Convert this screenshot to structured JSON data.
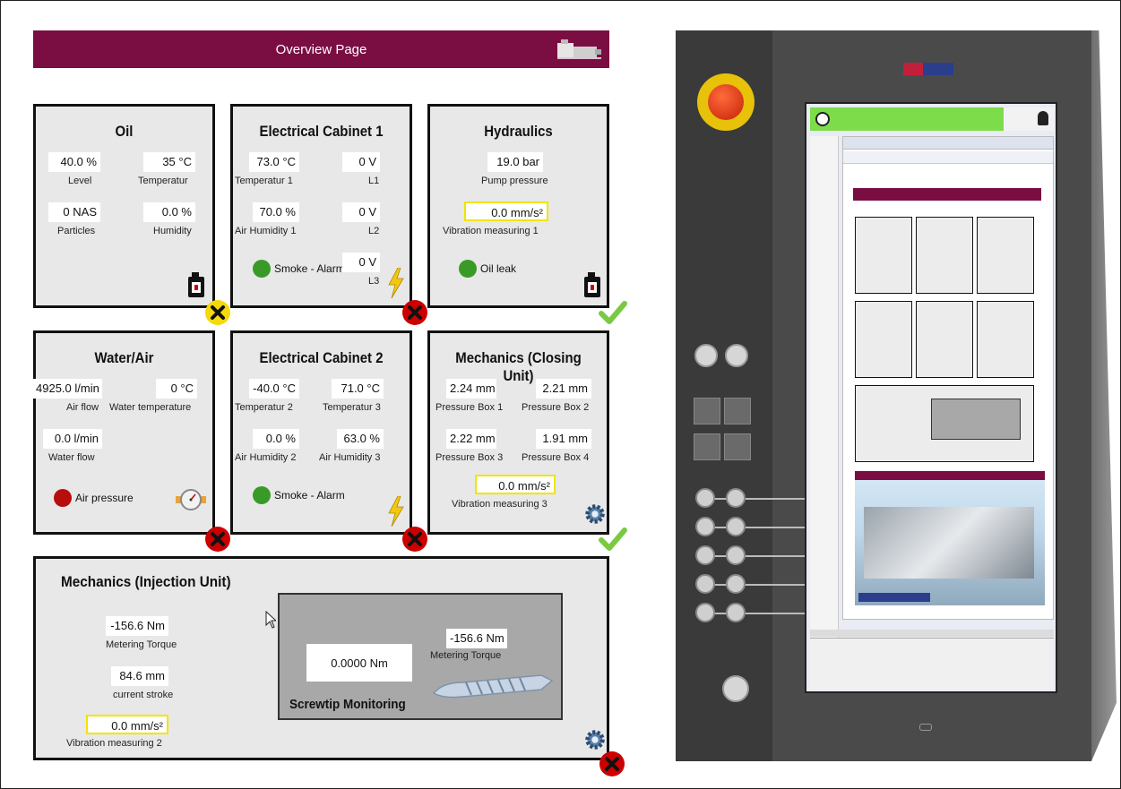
{
  "overview": {
    "title": "Overview Page",
    "panels": {
      "oil": {
        "title": "Oil",
        "level_value": "40.0 %",
        "level_label": "Level",
        "temp_value": "35 °C",
        "temp_label": "Temperatur",
        "particles_value": "0 NAS",
        "particles_label": "Particles",
        "humidity_value": "0.0 %",
        "humidity_label": "Humidity",
        "status": "warning"
      },
      "cabinet1": {
        "title": "Electrical Cabinet 1",
        "temp1_value": "73.0 °C",
        "temp1_label": "Temperatur 1",
        "l1_value": "0 V",
        "l1_label": "L1",
        "hum1_value": "70.0 %",
        "hum1_label": "Air Humidity 1",
        "l2_value": "0 V",
        "l2_label": "L2",
        "smoke_label": "Smoke - Alarm",
        "l3_value": "0 V",
        "l3_label": "L3",
        "status": "error"
      },
      "hydraulics": {
        "title": "Hydraulics",
        "pressure_value": "19.0 bar",
        "pressure_label": "Pump pressure",
        "vib_value": "0.0 mm/s²",
        "vib_label": "Vibration measuring 1",
        "leak_label": "Oil leak",
        "status": "ok"
      },
      "water_air": {
        "title": "Water/Air",
        "airflow_value": "4925.0 l/min",
        "airflow_label": "Air flow",
        "watertemp_value": "0 °C",
        "watertemp_label": "Water temperature",
        "waterflow_value": "0.0 l/min",
        "waterflow_label": "Water flow",
        "airpressure_label": "Air pressure",
        "status": "error"
      },
      "cabinet2": {
        "title": "Electrical Cabinet 2",
        "temp2_value": "-40.0 °C",
        "temp2_label": "Temperatur 2",
        "temp3_value": "71.0 °C",
        "temp3_label": "Temperatur 3",
        "hum2_value": "0.0 %",
        "hum2_label": "Air Humidity 2",
        "hum3_value": "63.0 %",
        "hum3_label": "Air Humidity 3",
        "smoke_label": "Smoke - Alarm",
        "status": "error"
      },
      "closing_unit": {
        "title": "Mechanics (Closing Unit)",
        "pb1_value": "2.24 mm",
        "pb1_label": "Pressure Box 1",
        "pb2_value": "2.21 mm",
        "pb2_label": "Pressure Box 2",
        "pb3_value": "2.22 mm",
        "pb3_label": "Pressure Box 3",
        "pb4_value": "1.91 mm",
        "pb4_label": "Pressure Box 4",
        "vib_value": "0.0 mm/s²",
        "vib_label": "Vibration measuring 3",
        "status": "ok"
      },
      "injection_unit": {
        "title": "Mechanics (Injection Unit)",
        "torque_value": "-156.6 Nm",
        "torque_label": "Metering Torque",
        "stroke_value": "84.6 mm",
        "stroke_label": "current stroke",
        "vib_value": "0.0 mm/s²",
        "vib_label": "Vibration measuring 2",
        "screwtip": {
          "value": "0.0000 Nm",
          "torque_value": "-156.6 Nm",
          "torque_label": "Metering Torque",
          "title": "Screwtip Monitoring"
        },
        "status": "error"
      }
    }
  },
  "colors": {
    "header": "#7a0e42",
    "ok": "#7ac943",
    "error": "#cc0000",
    "warning": "#f5d90a",
    "highlight_border": "#f2e400"
  }
}
